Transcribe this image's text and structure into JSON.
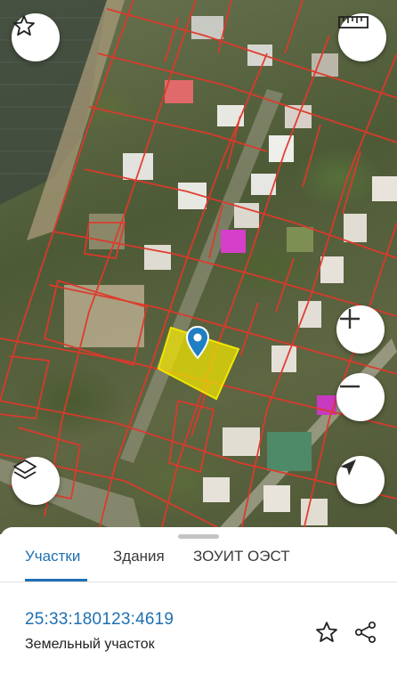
{
  "map": {
    "buttons": [
      {
        "name": "favorite-map-button",
        "icon": "star-icon"
      },
      {
        "name": "ruler-button",
        "icon": "ruler-icon"
      },
      {
        "name": "zoom-in-button",
        "icon": "plus-icon"
      },
      {
        "name": "zoom-out-button",
        "icon": "minus-icon"
      },
      {
        "name": "layers-button",
        "icon": "layers-icon"
      },
      {
        "name": "locate-button",
        "icon": "navigation-arrow-icon"
      }
    ],
    "selected_parcel_color": "#f2e600",
    "boundary_color": "#e0382b",
    "pin_color": "#1f7fc4"
  },
  "tabs": [
    {
      "label": "Участки",
      "active": true
    },
    {
      "label": "Здания",
      "active": false
    },
    {
      "label": "ЗОУИТ ОЭСТ",
      "active": false
    }
  ],
  "parcel": {
    "cadastral_number": "25:33:180123:4619",
    "type": "Земельный участок"
  },
  "colors": {
    "accent": "#1f6fb2"
  }
}
